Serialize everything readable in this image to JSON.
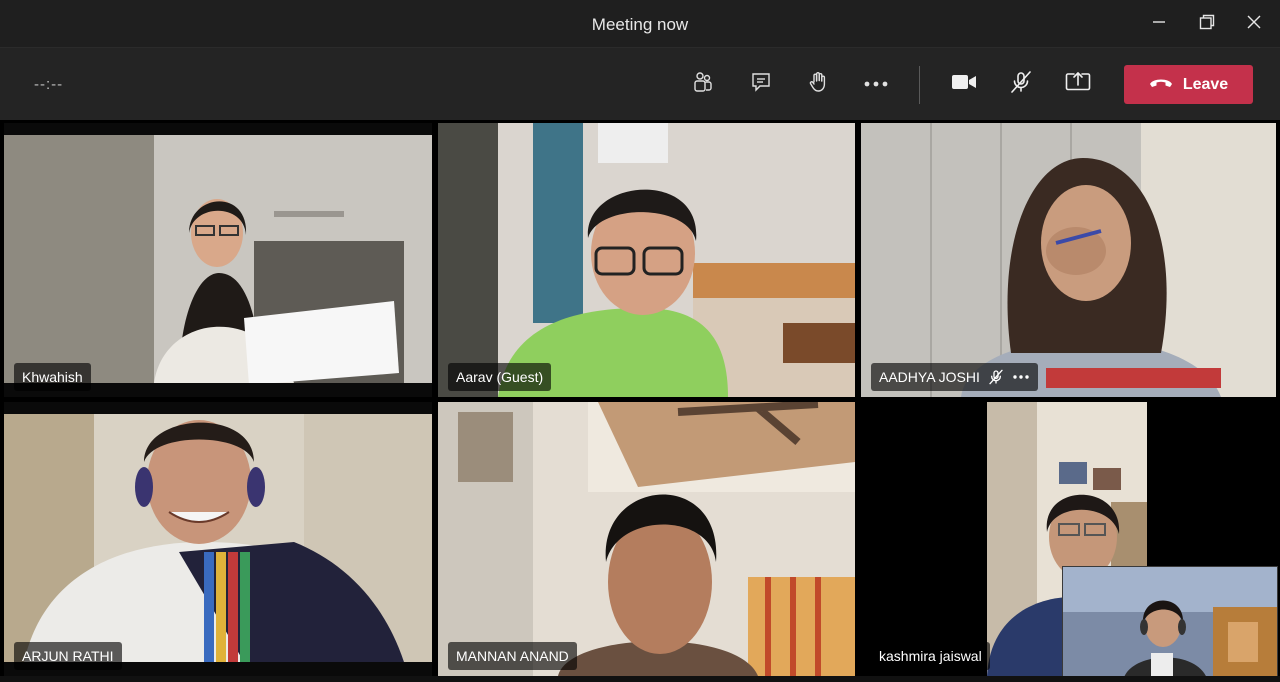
{
  "window": {
    "title": "Meeting now"
  },
  "toolbar": {
    "timer": "--:--",
    "buttons": {
      "participants": "people-icon",
      "chat": "chat-icon",
      "raise_hand": "hand-icon",
      "more": "more-icon",
      "camera": "video-camera-icon",
      "mic": "mic-muted-icon",
      "share": "share-screen-icon"
    },
    "leave_label": "Leave"
  },
  "participants": [
    {
      "name": "Khwahish"
    },
    {
      "name": "Aarav (Guest)"
    },
    {
      "name": "AADHYA JOSHI",
      "muted": true
    },
    {
      "name": "ARJUN RATHI"
    },
    {
      "name": "MANNAN ANAND"
    },
    {
      "name": "kashmira jaiswal"
    }
  ],
  "colors": {
    "leave": "#c4314b",
    "titlebar": "#1f1f1f",
    "toolbar": "#242424"
  }
}
